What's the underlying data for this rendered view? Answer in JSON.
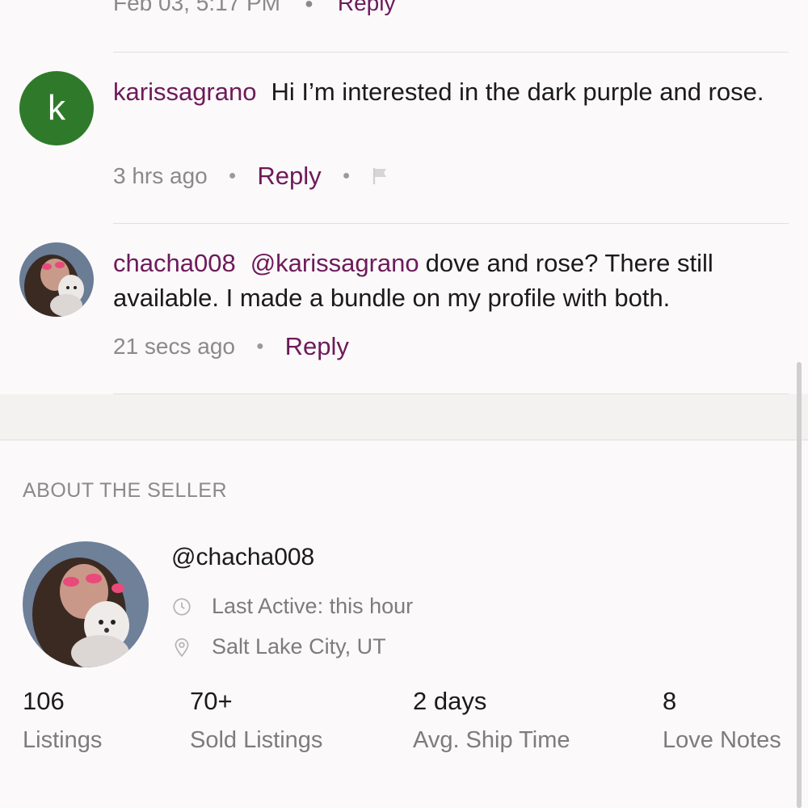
{
  "previous_comment": {
    "time": "Feb 03, 5:17 PM",
    "reply_label": "Reply"
  },
  "comments": [
    {
      "avatar_letter": "k",
      "username": "karissagrano",
      "text": "Hi I’m interested in the dark purple and rose.",
      "time": "3 hrs ago",
      "reply_label": "Reply",
      "has_flag": true,
      "avatar_color": "#2f7a2a"
    },
    {
      "username": "chacha008",
      "mention": "@karissagrano",
      "text": "dove and rose? There still available. I made a bundle on my profile with both.",
      "time": "21 secs ago",
      "reply_label": "Reply"
    }
  ],
  "seller": {
    "section_title": "ABOUT THE SELLER",
    "handle": "@chacha008",
    "last_active": "Last Active: this hour",
    "location": "Salt Lake City, UT",
    "stats": [
      {
        "value": "106",
        "label": "Listings"
      },
      {
        "value": "70+",
        "label": "Sold Listings"
      },
      {
        "value": "2 days",
        "label": "Avg. Ship Time"
      },
      {
        "value": "8",
        "label": "Love Notes"
      }
    ]
  },
  "icons": [
    "flag-icon",
    "clock-icon",
    "location-pin-icon"
  ],
  "colors": {
    "accent": "#6e1a5a",
    "avatar_green": "#2f7a2a",
    "muted": "#8a8a8a"
  }
}
